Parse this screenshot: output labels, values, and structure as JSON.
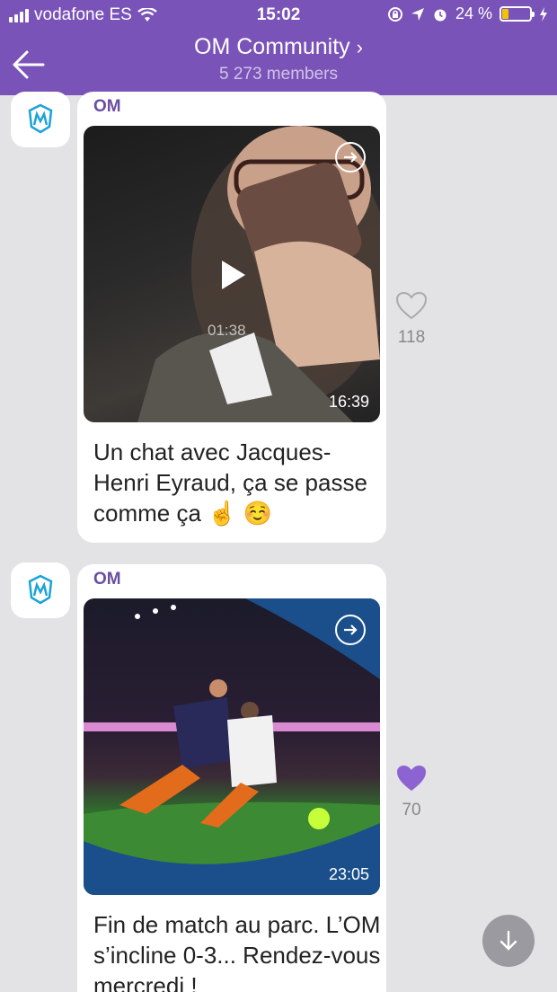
{
  "status": {
    "carrier": "vodafone ES",
    "time": "15:02",
    "battery": "24 %",
    "battery_level": 0.24
  },
  "header": {
    "title": "OM Community",
    "members": "5 273 members"
  },
  "messages": [
    {
      "sender": "OM",
      "video_elapsed": "01:38",
      "duration": "16:39",
      "text": "Un chat avec Jacques-Henri Eyraud, ça se passe comme ça ☝️ ☺️",
      "likes": "118",
      "liked": false
    },
    {
      "sender": "OM",
      "duration": "23:05",
      "text": "Fin de match au parc. L’OM s’incline 0-3... Rendez-vous mercredi !",
      "likes": "70",
      "liked": true
    }
  ],
  "colors": {
    "header": "#7a53b8",
    "accent": "#8d63d2",
    "background": "#e3e3e6"
  },
  "icons": [
    "back-arrow-icon",
    "share-icon",
    "play-icon",
    "heart-icon",
    "scroll-down-icon"
  ]
}
